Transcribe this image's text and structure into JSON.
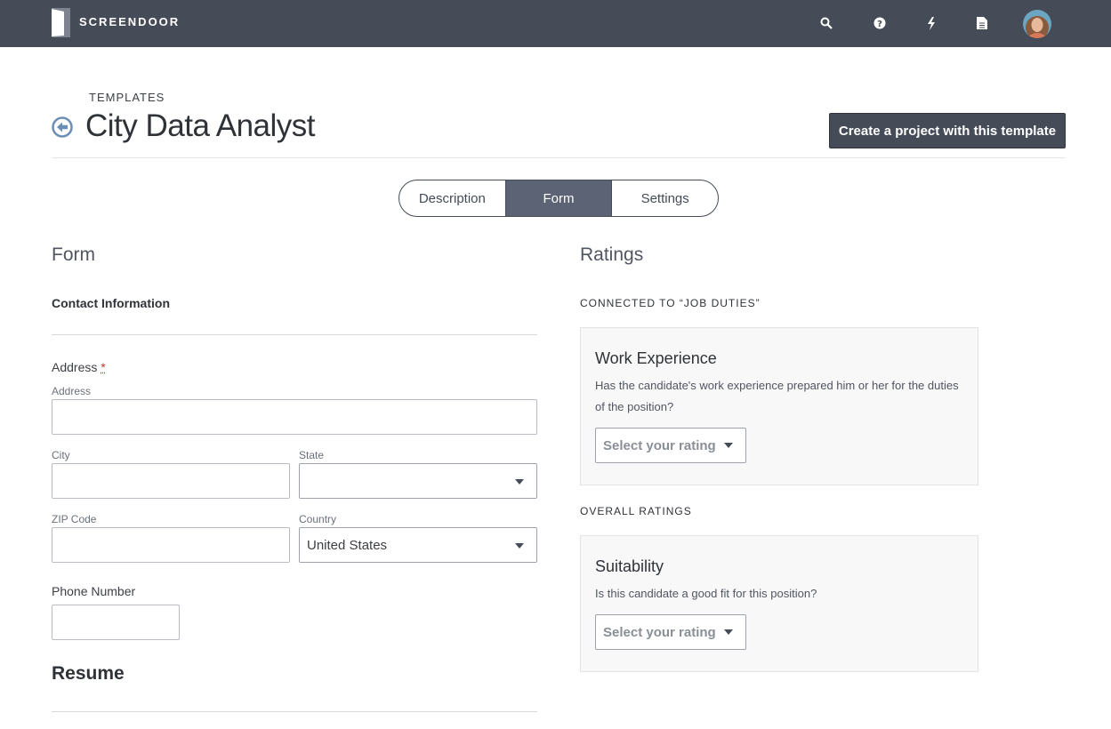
{
  "topbar": {
    "brand": "SCREENDOOR",
    "icons": [
      "search-icon",
      "help-icon",
      "bolt-icon",
      "document-icon"
    ],
    "colors": {
      "bar": "#454b57",
      "accent": "#5b6374"
    }
  },
  "header": {
    "breadcrumb": "TEMPLATES",
    "title": "City Data Analyst",
    "create_button": "Create a project with this template"
  },
  "tabs": [
    {
      "label": "Description",
      "active": false
    },
    {
      "label": "Form",
      "active": true
    },
    {
      "label": "Settings",
      "active": false
    }
  ],
  "form": {
    "heading": "Form",
    "group_title": "Contact Information",
    "address": {
      "label": "Address",
      "required_mark": "*",
      "address_sublabel": "Address",
      "address_value": "",
      "city_sublabel": "City",
      "city_value": "",
      "state_sublabel": "State",
      "state_value": "",
      "zip_sublabel": "ZIP Code",
      "zip_value": "",
      "country_sublabel": "Country",
      "country_value": "United States"
    },
    "phone": {
      "label": "Phone Number",
      "value": ""
    },
    "resume_heading": "Resume"
  },
  "ratings": {
    "heading": "Ratings",
    "connected_label": "CONNECTED TO “JOB DUTIES”",
    "work_experience": {
      "title": "Work Experience",
      "description": "Has the candidate's work experience prepared him or her for the duties of the position?",
      "select_placeholder": "Select your rating"
    },
    "overall_label": "OVERALL RATINGS",
    "suitability": {
      "title": "Suitability",
      "description": "Is this candidate a good fit for this position?",
      "select_placeholder": "Select your rating"
    }
  }
}
